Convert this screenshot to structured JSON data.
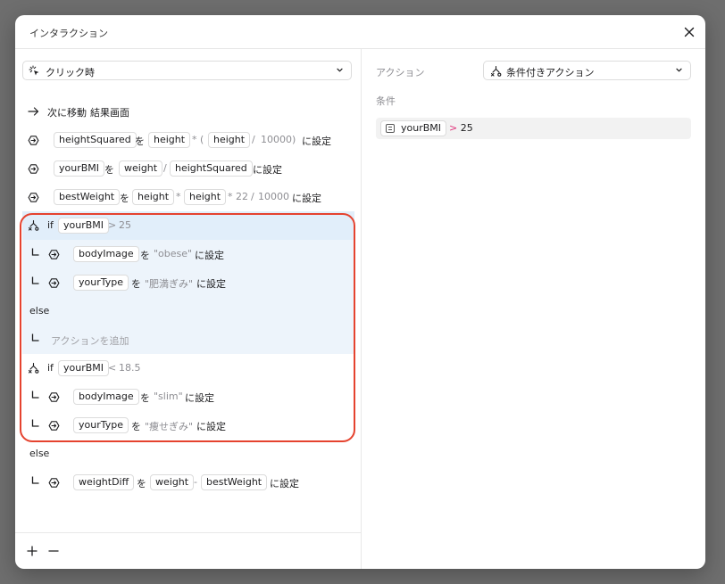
{
  "dialog": {
    "title": "インタラクション"
  },
  "trigger": {
    "label": "クリック時"
  },
  "lines": {
    "nav": {
      "label": "次に移動",
      "target": "結果画面"
    },
    "l1": {
      "var": "heightSquared",
      "wo": "を",
      "a": "height",
      "op1": "*",
      "p_open": "(",
      "b": "height",
      "op2": "/",
      "c": "10000",
      "p_close": ")",
      "suffix": "に設定"
    },
    "l2": {
      "var": "yourBMI",
      "wo": "を",
      "a": "weight",
      "op1": "/",
      "b": "heightSquared",
      "suffix": "に設定"
    },
    "l3": {
      "var": "bestWeight",
      "wo": "を",
      "a": "height",
      "op1": "*",
      "b": "height",
      "op2": "*",
      "c": "22",
      "op3": "/",
      "d": "10000",
      "suffix": "に設定"
    },
    "if1": {
      "kw": "if",
      "var": "yourBMI",
      "op": ">",
      "val": "25"
    },
    "l4": {
      "var": "bodyImage",
      "wo": "を",
      "val": "\"obese\"",
      "suffix": "に設定"
    },
    "l5": {
      "var": "yourType",
      "wo": "を",
      "val": "\"肥満ぎみ\"",
      "suffix": "に設定"
    },
    "else1": "else",
    "add_action": "アクションを追加",
    "if2": {
      "kw": "if",
      "var": "yourBMI",
      "op": "<",
      "val": "18.5"
    },
    "l6": {
      "var": "bodyImage",
      "wo": "を",
      "val": "\"slim\"",
      "suffix": "に設定"
    },
    "l7": {
      "var": "yourType",
      "wo": "を",
      "val": "\"痩せぎみ\"",
      "suffix": "に設定"
    },
    "else2": "else",
    "l8": {
      "var": "weightDiff",
      "wo": "を",
      "a": "weight",
      "op1": "-",
      "b": "bestWeight",
      "suffix": "に設定"
    }
  },
  "right": {
    "action_label": "アクション",
    "action_value": "条件付きアクション",
    "condition_label": "条件",
    "condition": {
      "var": "yourBMI",
      "op": ">",
      "val": "25"
    }
  },
  "colors": {
    "highlight_ring": "#e5432f",
    "selected_row": "#edf4fb",
    "operator_pink": "#e0337a"
  },
  "icons": [
    "close-icon",
    "cursor-click-icon",
    "chevron-down-icon",
    "arrow-right-icon",
    "set-variable-icon",
    "conditional-icon",
    "branch-corner-icon",
    "plus-icon",
    "minus-icon",
    "variable-icon"
  ]
}
